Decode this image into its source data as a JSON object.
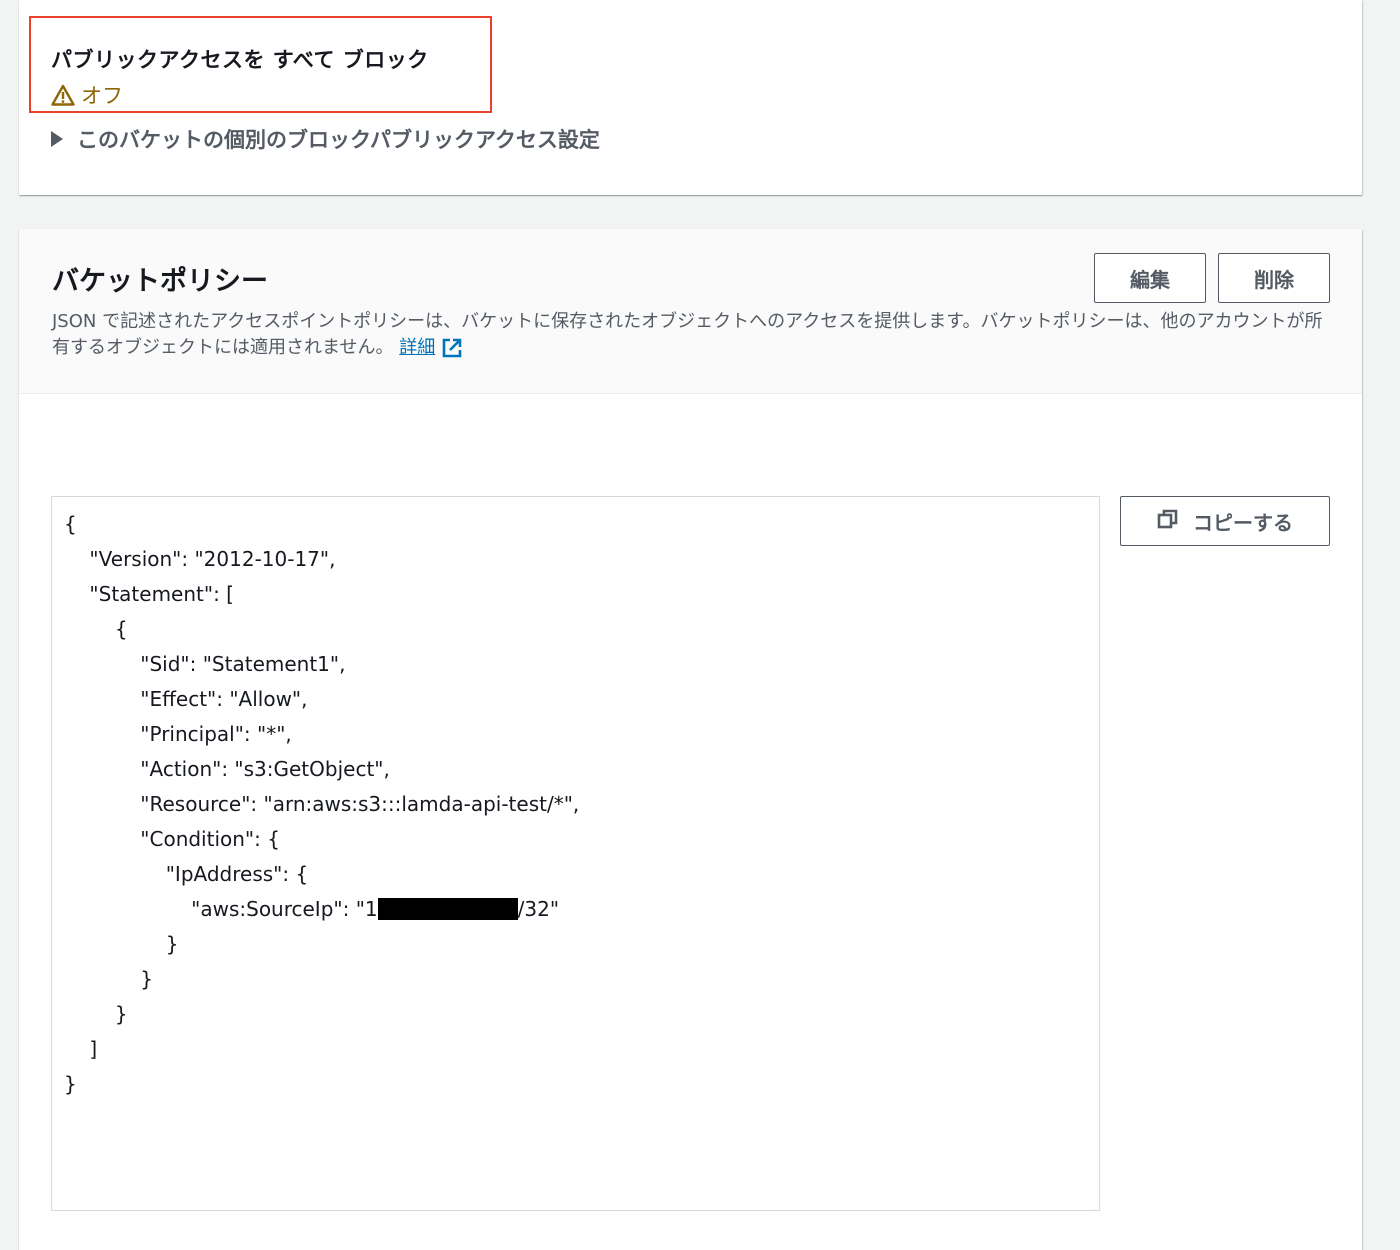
{
  "block_public_access": {
    "title": "パブリックアクセスを すべて ブロック",
    "status": "オフ",
    "status_icon": "warning-icon",
    "status_color": "#8d6605",
    "expander_label": "このバケットの個別のブロックパブリックアクセス設定"
  },
  "bucket_policy": {
    "title": "バケットポリシー",
    "description": "JSON で記述されたアクセスポイントポリシーは、バケットに保存されたオブジェクトへのアクセスを提供します。バケットポリシーは、他のアカウントが所有するオブジェクトには適用されません。",
    "learn_more_label": "詳細",
    "edit_label": "編集",
    "delete_label": "削除",
    "copy_label": "コピーする",
    "policy_lines": {
      "l01": "{",
      "l02": "    \"Version\": \"2012-10-17\",",
      "l03": "    \"Statement\": [",
      "l04": "        {",
      "l05": "            \"Sid\": \"Statement1\",",
      "l06": "            \"Effect\": \"Allow\",",
      "l07": "            \"Principal\": \"*\",",
      "l08": "            \"Action\": \"s3:GetObject\",",
      "l09": "            \"Resource\": \"arn:aws:s3:::lamda-api-test/*\",",
      "l10": "            \"Condition\": {",
      "l11": "                \"IpAddress\": {",
      "l12_prefix": "                    \"aws:SourceIp\": \"1",
      "l12_suffix": "/32\"",
      "l13": "                }",
      "l14": "            }",
      "l15": "        }",
      "l16": "    ]",
      "l17": "}"
    }
  },
  "colors": {
    "highlight_border": "#e8412c",
    "link": "#0073bb",
    "button_text": "#545b64",
    "page_background": "#f2f3f3"
  }
}
